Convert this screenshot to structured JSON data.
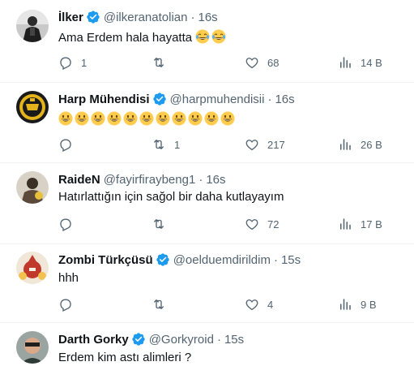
{
  "tweets": [
    {
      "name": "İlker",
      "handle": "@ilkeranatolian",
      "time": "16s",
      "text": "Ama Erdem hala hayatta",
      "emoji_count": 2,
      "replies": "1",
      "retweets": "",
      "likes": "68",
      "views": "14 B"
    },
    {
      "name": "Harp Mühendisi",
      "handle": "@harpmuhendisii",
      "time": "16s",
      "text": "",
      "emoji_count": 11,
      "replies": "",
      "retweets": "1",
      "likes": "217",
      "views": "26 B"
    },
    {
      "name": "RaideN",
      "handle": "@fayirfiraybeng1",
      "time": "16s",
      "text": "Hatırlattığın için sağol bir daha kutlayayım",
      "emoji_count": 0,
      "replies": "",
      "retweets": "",
      "likes": "72",
      "views": "17 B"
    },
    {
      "name": "Zombi Türkçüsü",
      "handle": "@oelduemdirildim",
      "time": "15s",
      "text": "hhh",
      "emoji_count": 0,
      "replies": "",
      "retweets": "",
      "likes": "4",
      "views": "9 B"
    },
    {
      "name": "Darth Gorky",
      "handle": "@Gorkyroid",
      "time": "15s",
      "text": "Erdem kim astı alimleri ?",
      "emoji_count": 0,
      "replies": "",
      "retweets": "",
      "likes": "",
      "views": ""
    }
  ],
  "colors": {
    "verified": "#1d9bf0",
    "muted": "#536471",
    "text": "#0f1419",
    "divider": "#eff3f4"
  },
  "icons": [
    "reply-icon",
    "retweet-icon",
    "like-icon",
    "views-icon",
    "verified-badge-icon",
    "joy-emoji-icon",
    "grinning-emoji-icon"
  ]
}
